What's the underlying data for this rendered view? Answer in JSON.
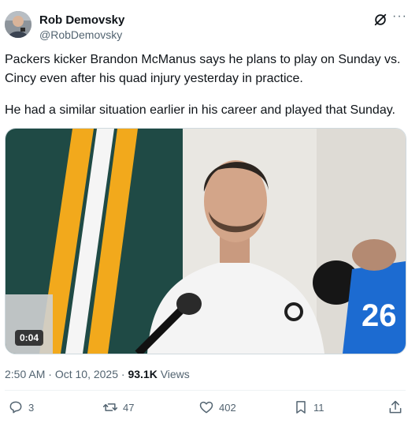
{
  "author": {
    "name": "Rob Demovsky",
    "handle": "@RobDemovsky"
  },
  "tweet": {
    "paragraphs": [
      "Packers kicker Brandon McManus says he plans to play on Sunday vs. Cincy even after his quad injury yesterday in practice.",
      "He had a similar situation earlier in his career and played that Sunday."
    ]
  },
  "media": {
    "duration": "0:04"
  },
  "meta": {
    "time": "2:50 AM",
    "separator": "·",
    "date": "Oct 10, 2025",
    "views_count": "93.1K",
    "views_label": "Views"
  },
  "actions": {
    "replies": "3",
    "reposts": "47",
    "likes": "402",
    "bookmarks": "11"
  },
  "icons": [
    "grok-icon",
    "more-icon",
    "reply-icon",
    "repost-icon",
    "like-icon",
    "bookmark-icon",
    "share-icon"
  ]
}
